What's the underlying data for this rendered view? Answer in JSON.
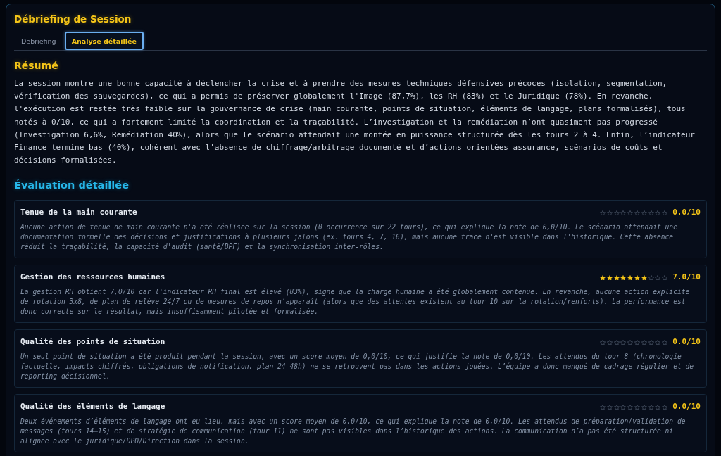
{
  "title": "Débriefing de Session",
  "tabs": [
    {
      "label": "Debriefing",
      "selected": false
    },
    {
      "label": "Analyse détaillée",
      "selected": true
    }
  ],
  "summary": {
    "heading": "Résumé",
    "text": "La session montre une bonne capacité à déclencher la crise et à prendre des mesures techniques défensives précoces (isolation, segmentation, vérification des sauvegardes), ce qui a permis de préserver globalement l'Image (87,7%), les RH (83%) et le Juridique (78%). En revanche, l'exécution est restée très faible sur la gouvernance de crise (main courante, points de situation, éléments de langage, plans formalisés), tous notés à 0/10, ce qui a fortement limité la coordination et la traçabilité. L’investigation et la remédiation n’ont quasiment pas progressé (Investigation 6,6%, Remédiation 40%), alors que le scénario attendait une montée en puissance structurée dès les tours 2 à 4. Enfin, l’indicateur Finance termine bas (40%), cohérent avec l'absence de chiffrage/arbitrage documenté et d’actions orientées assurance, scénarios de coûts et décisions formalisées."
  },
  "evaluation": {
    "heading": "Évaluation détaillée",
    "items": [
      {
        "title": "Tenue de la main courante",
        "stars": 0,
        "score": "0.0/10",
        "text": "Aucune action de tenue de main courante n'a été réalisée sur la session (0 occurrence sur 22 tours), ce qui explique la note de 0,0/10. Le scénario attendait une documentation formelle des décisions et justifications à plusieurs jalons (ex. tours 4, 7, 16), mais aucune trace n'est visible dans l'historique. Cette absence réduit la traçabilité, la capacité d'audit (santé/BPF) et la synchronisation inter-rôles."
      },
      {
        "title": "Gestion des ressources humaines",
        "stars": 7,
        "score": "7.0/10",
        "text": "La gestion RH obtient 7,0/10 car l'indicateur RH final est élevé (83%), signe que la charge humaine a été globalement contenue. En revanche, aucune action explicite de rotation 3x8, de plan de relève 24/7 ou de mesures de repos n’apparaît (alors que des attentes existent au tour 10 sur la rotation/renforts). La performance est donc correcte sur le résultat, mais insuffisamment pilotée et formalisée."
      },
      {
        "title": "Qualité des points de situation",
        "stars": 0,
        "score": "0.0/10",
        "text": "Un seul point de situation a été produit pendant la session, avec un score moyen de 0,0/10, ce qui justifie la note de 0,0/10. Les attendus du tour 8 (chronologie factuelle, impacts chiffrés, obligations de notification, plan 24-48h) ne se retrouvent pas dans les actions jouées. L’équipe a donc manqué de cadrage régulier et de reporting décisionnel."
      },
      {
        "title": "Qualité des éléments de langage",
        "stars": 0,
        "score": "0.0/10",
        "text": "Deux événements d’éléments de langage ont eu lieu, mais avec un score moyen de 0,0/10, ce qui explique la note de 0,0/10. Les attendus de préparation/validation de messages (tours 14–15) et de stratégie de communication (tour 11) ne sont pas visibles dans l’historique des actions. La communication n’a pas été structurée ni alignée avec le juridique/DPO/Direction dans la session."
      }
    ]
  }
}
